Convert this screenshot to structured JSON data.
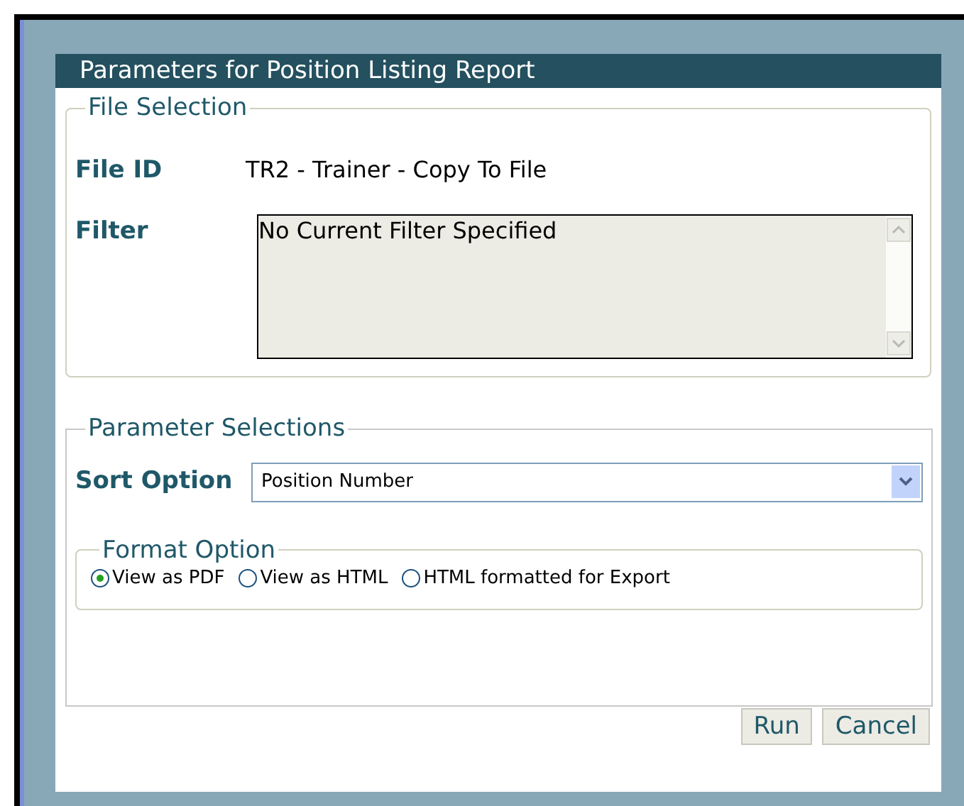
{
  "dialog": {
    "title": "Parameters for Position Listing Report"
  },
  "file_selection": {
    "legend": "File Selection",
    "file_id_label": "File ID",
    "file_id_value": "TR2 - Trainer - Copy To File",
    "filter_label": "Filter",
    "filter_value": "No Current Filter Specified"
  },
  "parameter_selections": {
    "legend": "Parameter Selections",
    "sort_label": "Sort Option",
    "sort_value": "Position Number",
    "format": {
      "legend": "Format Option",
      "options": [
        {
          "label": "View as PDF",
          "selected": true
        },
        {
          "label": "View as HTML",
          "selected": false
        },
        {
          "label": "HTML formatted for Export",
          "selected": false
        }
      ]
    }
  },
  "buttons": [
    "Run",
    "Cancel"
  ]
}
